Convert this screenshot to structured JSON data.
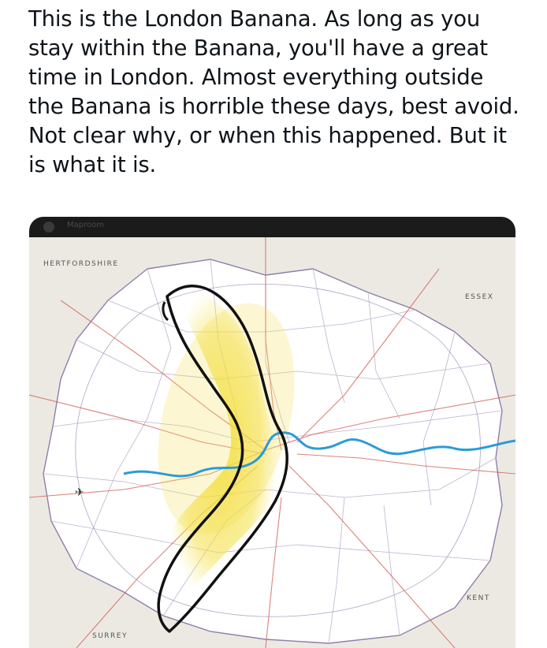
{
  "post": {
    "text": "This is the London Banana. As long as you stay within the Banana, you'll have a great time in London. Almost everything outside the Banana is horrible these days, best avoid. Not clear why, or when this happened. But it is what it is."
  },
  "media": {
    "watermark": "Maproom",
    "regions": {
      "north_west": "HERTFORDSHIRE",
      "north_east": "ESSEX",
      "south_east": "KENT",
      "south_west": "SURREY"
    },
    "colors": {
      "banana_highlight": "#f5e04a",
      "banana_outline": "#111111",
      "river": "#2a9bd8",
      "borough_fill": "#ffffff",
      "outside_fill": "#ece9e3",
      "roads": "#c9463f"
    }
  }
}
